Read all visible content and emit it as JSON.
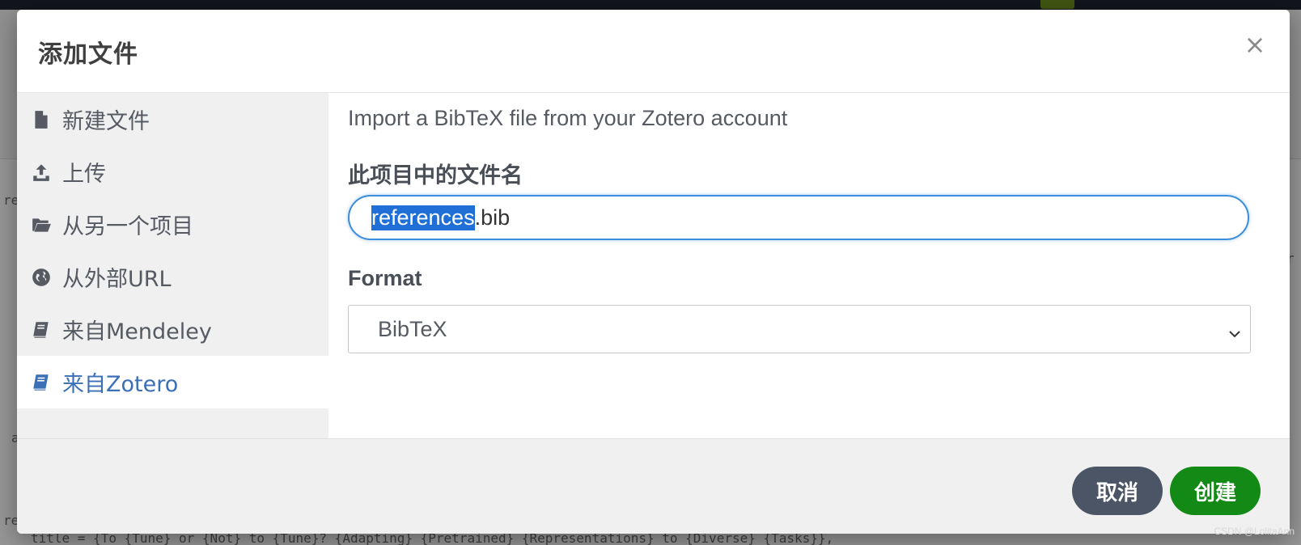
{
  "background": {
    "code_lines": [
      "re",
      "a",
      "re",
      "title = {To {Tune} or {Not} to {Tune}? {Adapting} {Pretrained} {Representations} to {Diverse} {Tasks}},",
      "r"
    ]
  },
  "modal": {
    "title": "添加文件",
    "close_glyph": "×",
    "sidebar": {
      "items": [
        {
          "label": "新建文件",
          "icon": "file-icon",
          "active": false
        },
        {
          "label": "上传",
          "icon": "upload-icon",
          "active": false
        },
        {
          "label": "从另一个项目",
          "icon": "folder-open-icon",
          "active": false
        },
        {
          "label": "从外部URL",
          "icon": "globe-icon",
          "active": false
        },
        {
          "label": "来自Mendeley",
          "icon": "book-icon",
          "active": false
        },
        {
          "label": "来自Zotero",
          "icon": "book-icon",
          "active": true
        }
      ]
    },
    "content": {
      "description": "Import a BibTeX file from your Zotero account",
      "filename_label": "此项目中的文件名",
      "filename_value_selected": "references",
      "filename_value_rest": ".bib",
      "format_label": "Format",
      "format_value": "BibTeX"
    },
    "footer": {
      "cancel_label": "取消",
      "create_label": "创建"
    }
  },
  "watermark": "CSDN @LolitaAnn",
  "colors": {
    "active_link": "#3b6fb6",
    "focus_border": "#3c8ddc",
    "cancel_button": "#4b5565",
    "create_button": "#138a16"
  }
}
